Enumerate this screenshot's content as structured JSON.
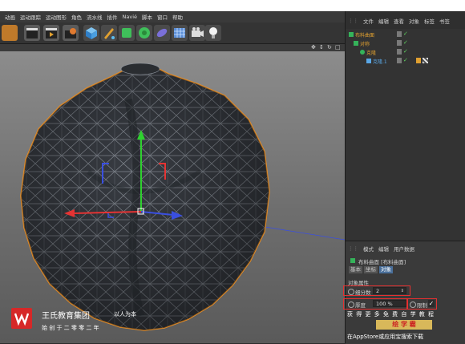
{
  "menu": [
    "动画",
    "运动跟踪",
    "运动图形",
    "角色",
    "流水线",
    "插件",
    "Navié",
    "脚本",
    "窗口",
    "帮助"
  ],
  "viewport_icons": [
    "✥",
    "↕",
    "↻",
    "□"
  ],
  "objects_panel": {
    "tabs": [
      "文件",
      "编辑",
      "查看",
      "对象",
      "标签",
      "书签"
    ],
    "items": [
      {
        "name": "布料曲面",
        "color": "#e0a030",
        "icon_color": "#35b35a"
      },
      {
        "name": "对称",
        "color": "#e0a030",
        "icon_color": "#35b35a"
      },
      {
        "name": "克隆",
        "color": "#e0a030",
        "icon_color": "#35b35a"
      },
      {
        "name": "克隆.1",
        "color": "#5aa7e6",
        "icon_color": "#5aa7e6"
      }
    ]
  },
  "attributes_panel": {
    "tabs": [
      "模式",
      "编辑",
      "用户数据"
    ],
    "object_title": "布料曲面 [布料曲面]",
    "subtabs": [
      "基本",
      "坐标",
      "对象"
    ],
    "active_subtab": "对象",
    "section": "对象属性",
    "subdivisions_label": "细分数",
    "subdivisions_value": "2",
    "thickness_label": "厚度",
    "thickness_value": "100 %",
    "limit_label": "限制",
    "limit_check": "✓"
  },
  "watermark_left": {
    "company": "王氏教育集团",
    "slogan": "以人为本",
    "founded": "始 创 于 二 零 零 二 年"
  },
  "watermark_right": {
    "line1": "获 得 更 多 免 费 自 学 教 程",
    "app_name": "绘 学 霸",
    "line3": "在AppStore或应用宝搜索下载"
  },
  "colors": {
    "accent_orange": "#e0a030",
    "highlight_red": "#e53030",
    "axis_y": "#2fd12f",
    "axis_x": "#e53333",
    "axis_z": "#3a4fe0",
    "mesh": "#3d4148",
    "outline": "#e8902a"
  }
}
